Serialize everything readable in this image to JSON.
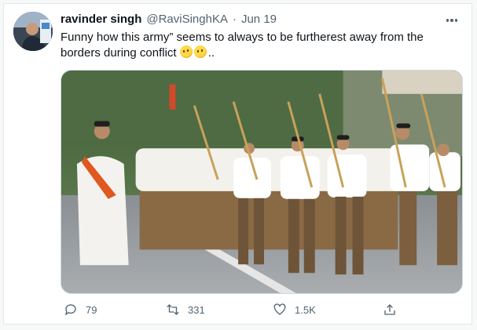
{
  "tweet": {
    "author_name": "ravinder singh",
    "handle": "@RaviSinghKA",
    "separator": "·",
    "date": "Jun 19",
    "text": "Funny how this army” seems to always to be furtherest away from the borders during conflict",
    "text_suffix": "..",
    "emojis": [
      "thinking-face",
      "thinking-face"
    ],
    "media_description": ""
  },
  "actions": {
    "reply_count": "79",
    "retweet_count": "331",
    "like_count": "1.5K"
  },
  "icons": {
    "more": "more-horizontal-icon",
    "reply": "reply-icon",
    "retweet": "retweet-icon",
    "like": "heart-icon",
    "share": "share-icon"
  },
  "colors": {
    "name": "#0f1419",
    "secondary": "#536471",
    "background": "#ffffff",
    "border": "#e1e8ed"
  }
}
